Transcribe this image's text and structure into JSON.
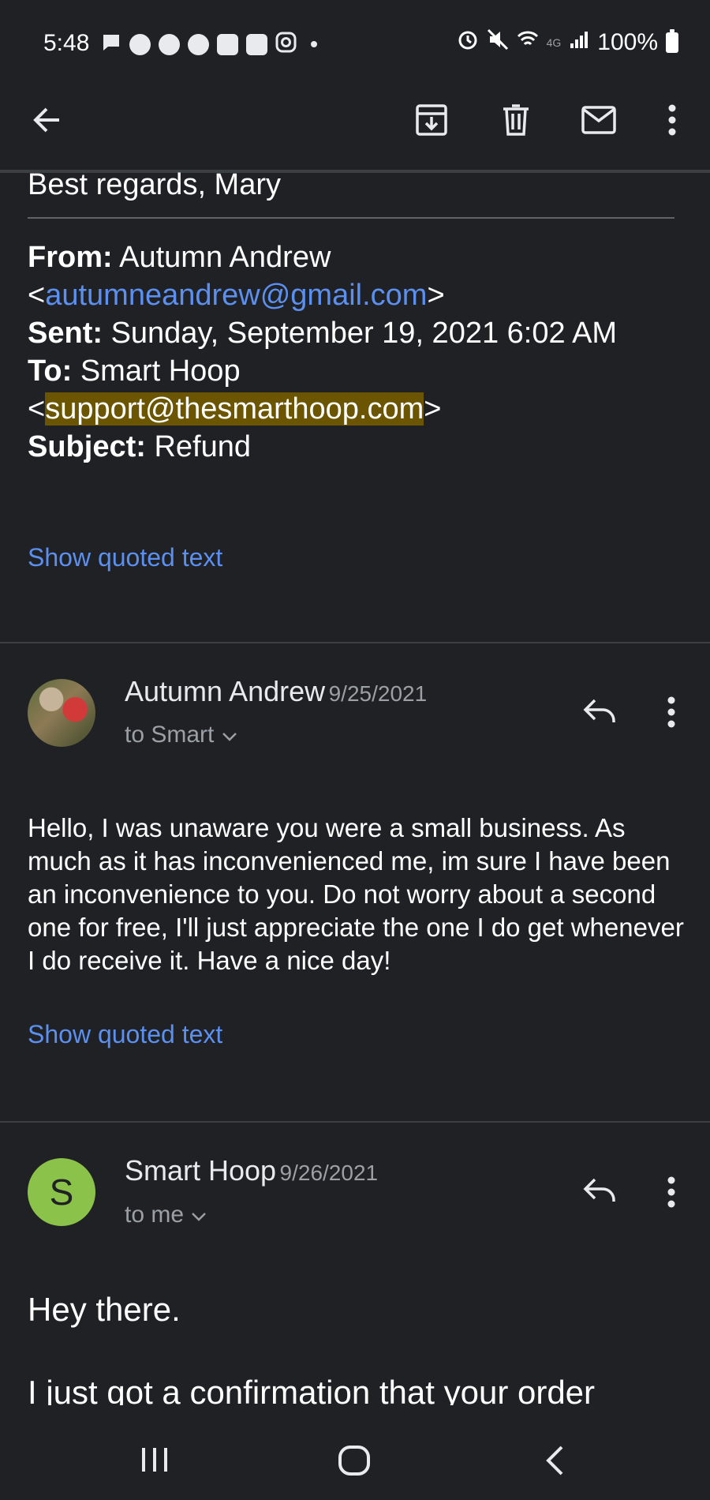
{
  "status_bar": {
    "time": "5:48",
    "network": "4G",
    "battery_percent": "100%",
    "icons": [
      "chat-icon",
      "facebook-icon",
      "facebook-icon",
      "facebook-icon",
      "messenger-icon",
      "messenger-icon",
      "instagram-icon",
      "dot-icon",
      "alarm-icon",
      "mute-icon",
      "wifi-icon",
      "signal-icon",
      "battery-icon"
    ]
  },
  "toolbar": {
    "icons": [
      "back-arrow-icon",
      "archive-icon",
      "delete-icon",
      "mark-unread-icon",
      "more-vert-icon"
    ]
  },
  "quoted_block": {
    "closing": "Best regards, Mary",
    "from_label": "From:",
    "from_name": "Autumn Andrew",
    "from_email": "autumneandrew@gmail.com",
    "sent_label": "Sent:",
    "sent_value": "Sunday, September 19, 2021 6:02 AM",
    "to_label": "To:",
    "to_name": "Smart Hoop",
    "to_email": "support@thesmarthoop.com",
    "subject_label": "Subject:",
    "subject_value": "Refund",
    "show_quoted": "Show quoted text"
  },
  "messages": [
    {
      "sender": "Autumn Andrew",
      "date": "9/25/2021",
      "recipient": "to Smart",
      "body": "Hello, I was unaware you were a small business. As much as it has inconvenienced me, im sure I have been an inconvenience to you. Do not worry about a second one for free, I'll just appreciate the one I do get whenever I do receive it. Have a nice day!",
      "show_quoted": "Show quoted text"
    },
    {
      "sender": "Smart Hoop",
      "avatar_letter": "S",
      "date": "9/26/2021",
      "recipient": "to me",
      "body_line1": "Hey there.",
      "body_line2": "I just got a confirmation that your order"
    }
  ],
  "colors": {
    "background": "#202124",
    "link": "#5b8ff0",
    "highlight": "#6b5500",
    "avatar_s": "#8bc34a"
  }
}
